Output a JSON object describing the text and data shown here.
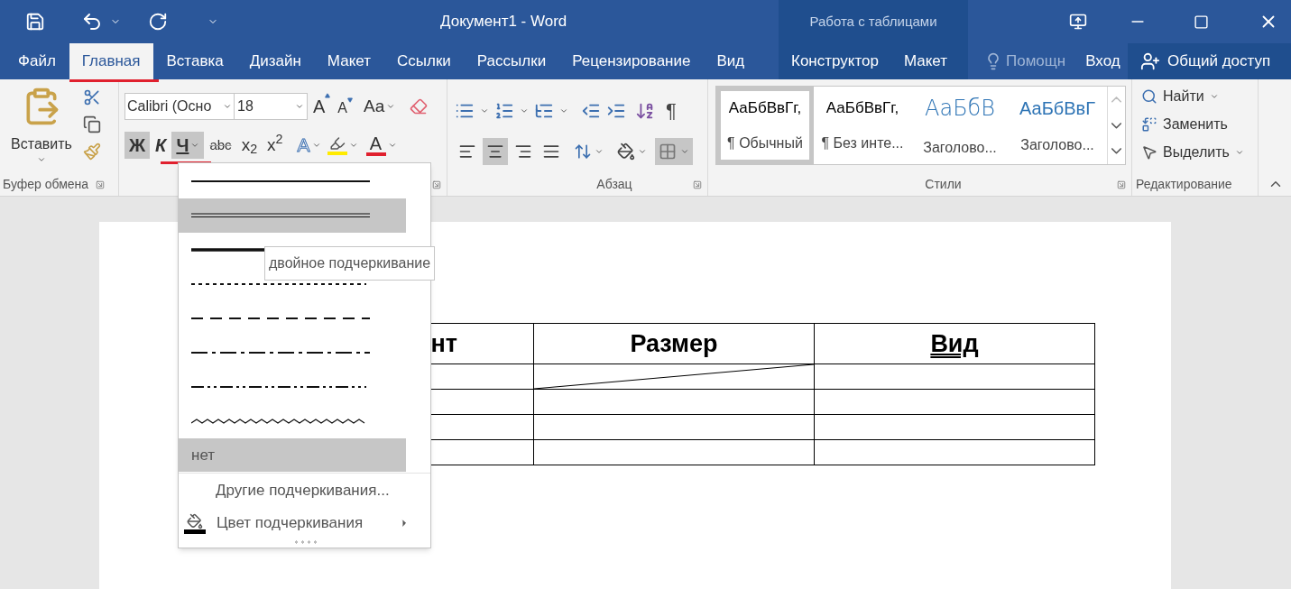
{
  "title_bar": {
    "title": "Документ1 - Word",
    "context_title": "Работа с таблицами"
  },
  "tabs": [
    {
      "label": "Файл",
      "kind": "tab",
      "selected": false,
      "marked": false
    },
    {
      "label": "Главная",
      "kind": "tab",
      "selected": true,
      "marked": true
    },
    {
      "label": "Вставка",
      "kind": "tab",
      "selected": false,
      "marked": false
    },
    {
      "label": "Дизайн",
      "kind": "tab",
      "selected": false,
      "marked": false
    },
    {
      "label": "Макет",
      "kind": "tab",
      "selected": false,
      "marked": false
    },
    {
      "label": "Ссылки",
      "kind": "tab",
      "selected": false,
      "marked": false
    },
    {
      "label": "Рассылки",
      "kind": "tab",
      "selected": false,
      "marked": false
    },
    {
      "label": "Рецензирование",
      "kind": "tab",
      "selected": false,
      "marked": false
    },
    {
      "label": "Вид",
      "kind": "tab",
      "selected": false,
      "marked": false
    },
    {
      "label": "Конструктор",
      "kind": "context",
      "selected": false,
      "marked": false
    },
    {
      "label": "Макет",
      "kind": "context",
      "selected": false,
      "marked": false
    },
    {
      "label": "Помощн",
      "kind": "help",
      "selected": false,
      "marked": false
    },
    {
      "label": "Вход",
      "kind": "signin",
      "selected": false,
      "marked": false
    },
    {
      "label": "Общий доступ",
      "kind": "share",
      "selected": false,
      "marked": false
    }
  ],
  "ribbon": {
    "clipboard": {
      "paste_label": "Вставить",
      "group_label": "Буфер обмена"
    },
    "font": {
      "font_name": "Calibri (Осно",
      "font_size": "18",
      "grow": "A",
      "shrink": "A",
      "case": "Aa",
      "effects": "A",
      "font_color": "A",
      "format_buttons": [
        {
          "kind": "bold",
          "label": "Ж",
          "selected": true,
          "marked": false
        },
        {
          "kind": "italic",
          "label": "К",
          "selected": false,
          "marked": false
        },
        {
          "kind": "underline",
          "label": "Ч",
          "selected": true,
          "marked": true
        },
        {
          "kind": "strike",
          "label": "abc",
          "selected": false,
          "marked": false
        },
        {
          "kind": "sub",
          "label": "x$_{2}$",
          "selected": false,
          "marked": false
        },
        {
          "kind": "sup",
          "label": "x$^{2}$",
          "selected": false,
          "marked": false
        }
      ]
    },
    "paragraph": {
      "pilcrow": "¶",
      "group_label": "Абзац",
      "borders_selected": true,
      "align_buttons": [
        {
          "kind": "left",
          "selected": false
        },
        {
          "kind": "center",
          "selected": true
        },
        {
          "kind": "right",
          "selected": false
        },
        {
          "kind": "justify",
          "selected": false
        }
      ]
    },
    "styles": {
      "group_label": "Стили",
      "items": [
        {
          "preview": "АаБбВвГг,",
          "name": "¶ Обычный",
          "kind": "normal",
          "selected": true
        },
        {
          "preview": "АаБбВвГг,",
          "name": "¶ Без инте...",
          "kind": "normal",
          "selected": false
        },
        {
          "preview": "АаБбВ",
          "name": "Заголово...",
          "kind": "heading1",
          "selected": false
        },
        {
          "preview": "АаБбВвГ",
          "name": "Заголово...",
          "kind": "heading2",
          "selected": false
        }
      ]
    },
    "editing": {
      "group_label": "Редактирование",
      "items": [
        {
          "label": "Найти",
          "kind": "find"
        },
        {
          "label": "Заменить",
          "kind": "replace"
        },
        {
          "label": "Выделить",
          "kind": "select"
        }
      ]
    }
  },
  "underline_menu": {
    "styles": [
      {
        "kind": "solid",
        "highlighted": false
      },
      {
        "kind": "double",
        "highlighted": true
      },
      {
        "kind": "thick",
        "highlighted": false
      },
      {
        "kind": "dotted",
        "highlighted": false
      },
      {
        "kind": "dash",
        "highlighted": false
      },
      {
        "kind": "dashdot",
        "highlighted": false
      },
      {
        "kind": "dashdotdot",
        "highlighted": false
      },
      {
        "kind": "wave",
        "highlighted": false
      }
    ],
    "none": {
      "label": "нет",
      "highlighted": true
    },
    "more": "Другие подчеркивания...",
    "color_label": "Цвет подчеркивания",
    "tooltip": "двойное подчеркивание"
  },
  "document": {
    "table": {
      "header": [
        {
          "text": "нт",
          "double_underline": false
        },
        {
          "text": "Размер",
          "double_underline": false
        },
        {
          "text": "Вид",
          "double_underline": true
        }
      ],
      "rows": [
        {
          "diagonal_split": true
        },
        {
          "diagonal_split": false
        },
        {
          "diagonal_split": false
        },
        {
          "diagonal_split": false
        }
      ]
    }
  }
}
